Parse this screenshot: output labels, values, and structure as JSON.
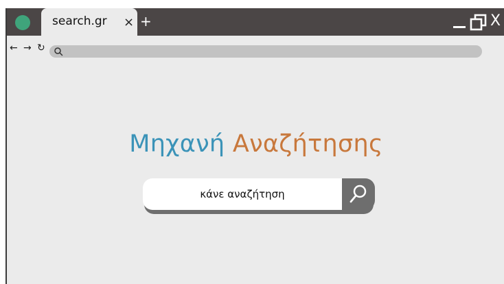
{
  "browser": {
    "tab_title": "search.gr",
    "tab_close": "×",
    "new_tab": "+",
    "close_window": "X",
    "nav": {
      "back": "←",
      "forward": "→",
      "reload": "↻"
    }
  },
  "page": {
    "logo_word1": "Μηχανή",
    "logo_word2": "Αναζήτησης",
    "search_placeholder": "κάνε αναζήτηση"
  },
  "colors": {
    "titlebar": "#4b4646",
    "logo_blue": "#3b93b8",
    "logo_orange": "#c8783c",
    "search_button": "#6e6e6e"
  },
  "icons": {
    "app": "app-dot-icon",
    "restore": "restore-icon",
    "search": "search-icon"
  }
}
